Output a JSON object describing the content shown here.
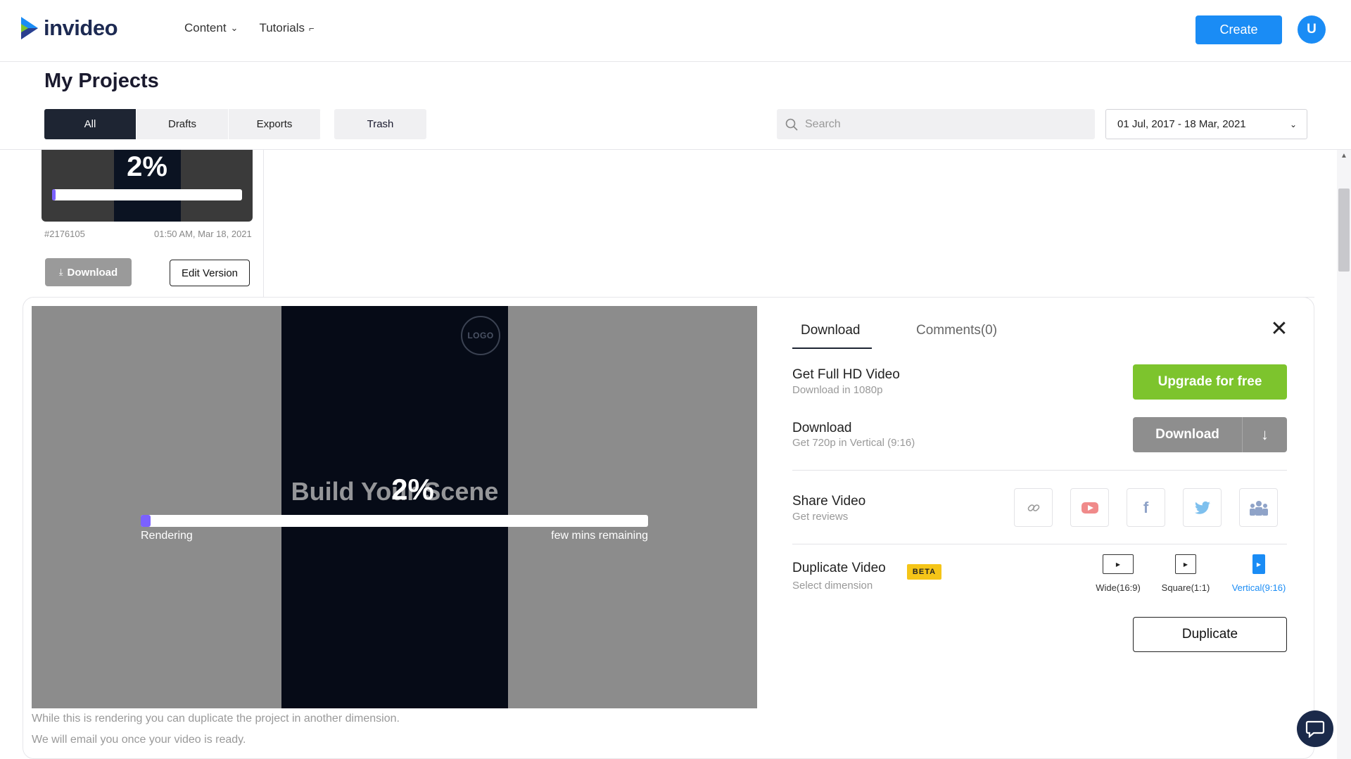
{
  "header": {
    "logo_text": "invideo",
    "nav": [
      {
        "label": "Content"
      },
      {
        "label": "Tutorials"
      }
    ],
    "create_label": "Create",
    "avatar_initial": "U"
  },
  "page": {
    "title": "My Projects",
    "tabs": [
      {
        "label": "All",
        "active": true
      },
      {
        "label": "Drafts",
        "active": false
      },
      {
        "label": "Exports",
        "active": false
      }
    ],
    "trash_label": "Trash",
    "search_placeholder": "Search",
    "date_range": "01 Jul, 2017 - 18 Mar, 2021"
  },
  "previous_card": {
    "progress_text": "2%",
    "progress": 0.02,
    "id": "#2176105",
    "timestamp": "01:50 AM, Mar 18, 2021",
    "download_label": "Download",
    "edit_label": "Edit Version"
  },
  "preview": {
    "logo_text": "LOGO",
    "scene_title": "Build Your Scene",
    "progress_text": "2%",
    "progress": 0.02,
    "status_left": "Rendering",
    "status_right": "few mins remaining",
    "note_1": "While this is rendering you can duplicate the project in another dimension.",
    "note_2": "We will email you once your video is ready."
  },
  "panel": {
    "tabs": [
      {
        "label": "Download",
        "active": true
      },
      {
        "label": "Comments(0)",
        "active": false
      }
    ],
    "full_hd": {
      "title": "Get Full HD Video",
      "subtitle": "Download in 1080p",
      "button": "Upgrade for free"
    },
    "download": {
      "title": "Download",
      "subtitle": "Get 720p in Vertical (9:16)",
      "button": "Download"
    },
    "share": {
      "title": "Share Video",
      "subtitle": "Get reviews",
      "buttons": [
        {
          "icon": "link-icon",
          "color": "#999999"
        },
        {
          "icon": "youtube-icon",
          "color": "#f08a8a"
        },
        {
          "icon": "facebook-icon",
          "color": "#8fa3c8"
        },
        {
          "icon": "twitter-icon",
          "color": "#7ec0ee"
        },
        {
          "icon": "team-icon",
          "color": "#8fa3c8"
        }
      ]
    },
    "duplicate": {
      "title": "Duplicate Video",
      "badge": "BETA",
      "subtitle": "Select dimension",
      "dimensions": [
        {
          "label": "Wide(16:9)",
          "selected": false
        },
        {
          "label": "Square(1:1)",
          "selected": false
        },
        {
          "label": "Vertical(9:16)",
          "selected": true
        }
      ],
      "button": "Duplicate"
    }
  },
  "colors": {
    "accent": "#1a8cf5",
    "upgrade": "#7dc42d",
    "progress": "#7b61ff",
    "dark": "#1e2533"
  }
}
